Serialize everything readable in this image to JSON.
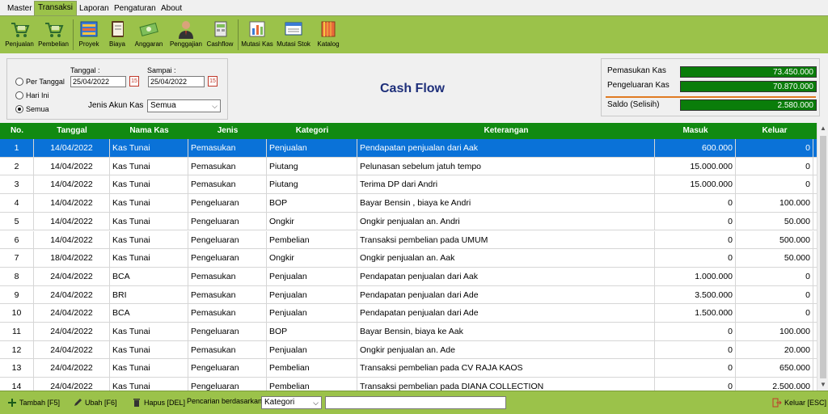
{
  "menu": {
    "tabs": [
      "Master",
      "Transaksi",
      "Laporan",
      "Pengaturan",
      "About"
    ],
    "active": "Transaksi"
  },
  "toolbar": {
    "items": [
      {
        "label": "Penjualan",
        "icon": "cart-icon"
      },
      {
        "label": "Pembelian",
        "icon": "cart-icon"
      },
      {
        "label": "Proyek",
        "icon": "project-icon"
      },
      {
        "label": "Biaya",
        "icon": "book-icon"
      },
      {
        "label": "Anggaran",
        "icon": "money-icon"
      },
      {
        "label": "Penggajian",
        "icon": "person-icon"
      },
      {
        "label": "Cashflow",
        "icon": "cashflow-icon"
      },
      {
        "label": "Mutasi Kas",
        "icon": "chart-icon"
      },
      {
        "label": "Mutasi Stok",
        "icon": "stock-icon"
      },
      {
        "label": "Katalog",
        "icon": "catalog-icon"
      }
    ]
  },
  "filter": {
    "tanggal_label": "Tanggal :",
    "sampai_label": "Sampai :",
    "tanggal_value": "25/04/2022",
    "sampai_value": "25/04/2022",
    "radio_per_tanggal": "Per Tanggal",
    "radio_hari_ini": "Hari Ini",
    "radio_semua": "Semua",
    "selected_radio": "Semua",
    "jenis_label": "Jenis Akun Kas",
    "jenis_value": "Semua",
    "cal_glyph": "15"
  },
  "page_title": "Cash Flow",
  "summary": {
    "pemasukan_label": "Pemasukan Kas",
    "pemasukan_value": "73.450.000",
    "pengeluaran_label": "Pengeluaran Kas",
    "pengeluaran_value": "70.870.000",
    "saldo_label": "Saldo (Selisih)",
    "saldo_value": "2.580.000"
  },
  "table": {
    "columns": [
      "No.",
      "Tanggal",
      "Nama Kas",
      "Jenis",
      "Kategori",
      "Keterangan",
      "Masuk",
      "Keluar"
    ],
    "rows": [
      [
        "1",
        "14/04/2022",
        "Kas Tunai",
        "Pemasukan",
        "Penjualan",
        "Pendapatan penjualan dari Aak",
        "600.000",
        "0"
      ],
      [
        "2",
        "14/04/2022",
        "Kas Tunai",
        "Pemasukan",
        "Piutang",
        "Pelunasan sebelum jatuh tempo",
        "15.000.000",
        "0"
      ],
      [
        "3",
        "14/04/2022",
        "Kas Tunai",
        "Pemasukan",
        "Piutang",
        "Terima DP dari Andri",
        "15.000.000",
        "0"
      ],
      [
        "4",
        "14/04/2022",
        "Kas Tunai",
        "Pengeluaran",
        "BOP",
        "Bayar Bensin , biaya ke Andri",
        "0",
        "100.000"
      ],
      [
        "5",
        "14/04/2022",
        "Kas Tunai",
        "Pengeluaran",
        "Ongkir",
        "Ongkir penjualan an. Andri",
        "0",
        "50.000"
      ],
      [
        "6",
        "14/04/2022",
        "Kas Tunai",
        "Pengeluaran",
        "Pembelian",
        "Transaksi pembelian pada UMUM",
        "0",
        "500.000"
      ],
      [
        "7",
        "18/04/2022",
        "Kas Tunai",
        "Pengeluaran",
        "Ongkir",
        "Ongkir penjualan an. Aak",
        "0",
        "50.000"
      ],
      [
        "8",
        "24/04/2022",
        "BCA",
        "Pemasukan",
        "Penjualan",
        "Pendapatan penjualan dari Aak",
        "1.000.000",
        "0"
      ],
      [
        "9",
        "24/04/2022",
        "BRI",
        "Pemasukan",
        "Penjualan",
        "Pendapatan penjualan dari Ade",
        "3.500.000",
        "0"
      ],
      [
        "10",
        "24/04/2022",
        "BCA",
        "Pemasukan",
        "Penjualan",
        "Pendapatan penjualan dari Ade",
        "1.500.000",
        "0"
      ],
      [
        "11",
        "24/04/2022",
        "Kas Tunai",
        "Pengeluaran",
        "BOP",
        "Bayar Bensin, biaya ke Aak",
        "0",
        "100.000"
      ],
      [
        "12",
        "24/04/2022",
        "Kas Tunai",
        "Pemasukan",
        "Penjualan",
        "Ongkir penjualan an. Ade",
        "0",
        "20.000"
      ],
      [
        "13",
        "24/04/2022",
        "Kas Tunai",
        "Pengeluaran",
        "Pembelian",
        "Transaksi pembelian pada CV RAJA KAOS",
        "0",
        "650.000"
      ],
      [
        "14",
        "24/04/2022",
        "Kas Tunai",
        "Pengeluaran",
        "Pembelian",
        "Transaksi pembelian pada DIANA COLLECTION",
        "0",
        "2.500.000"
      ]
    ],
    "selected_row": 0
  },
  "bottombar": {
    "tambah": "Tambah [F5]",
    "ubah": "Ubah [F6]",
    "hapus": "Hapus [DEL]",
    "search_label": "Pencarian berdasarkan :",
    "search_field": "Kategori",
    "search_value": "",
    "keluar": "Keluar [ESC]"
  },
  "colors": {
    "ribbon": "#9bc24a",
    "header": "#118a11",
    "selected": "#0a72d8",
    "summary_value": "#0a7d0a",
    "title": "#1e2f7a"
  }
}
